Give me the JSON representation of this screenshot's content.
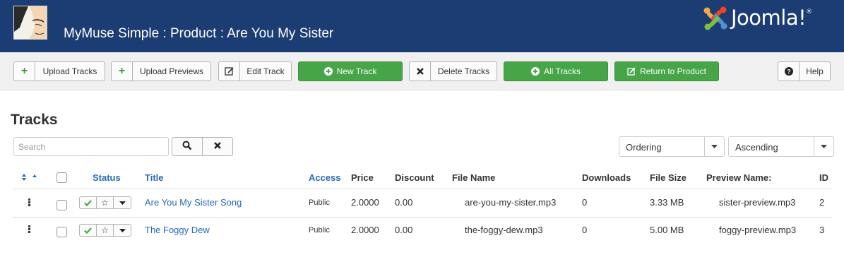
{
  "header": {
    "title": "MyMuse Simple : Product : Are You My Sister",
    "brand": "Joomla!",
    "brand_mark": "®"
  },
  "toolbar": {
    "upload_tracks": "Upload Tracks",
    "upload_previews": "Upload Previews",
    "edit_track": "Edit Track",
    "new_track": "New Track",
    "delete_tracks": "Delete Tracks",
    "all_tracks": "All Tracks",
    "return_to_product": "Return to Product",
    "help": "Help"
  },
  "section": {
    "title": "Tracks"
  },
  "filters": {
    "search_placeholder": "Search",
    "ordering": "Ordering",
    "direction": "Ascending"
  },
  "columns": {
    "status": "Status",
    "title": "Title",
    "access": "Access",
    "price": "Price",
    "discount": "Discount",
    "file_name": "File Name",
    "downloads": "Downloads",
    "file_size": "File Size",
    "preview_name": "Preview Name:",
    "id": "ID"
  },
  "rows": [
    {
      "title": "Are You My Sister Song",
      "access": "Public",
      "price": "2.0000",
      "discount": "0.00",
      "file_name": "are-you-my-sister.mp3",
      "downloads": "0",
      "file_size": "3.33 MB",
      "preview_name": "sister-preview.mp3",
      "id": "2"
    },
    {
      "title": "The Foggy Dew",
      "access": "Public",
      "price": "2.0000",
      "discount": "0.00",
      "file_name": "the-foggy-dew.mp3",
      "downloads": "0",
      "file_size": "5.00 MB",
      "preview_name": "foggy-preview.mp3",
      "id": "3"
    }
  ],
  "icons": {
    "plus": "plus-icon",
    "edit": "edit-icon",
    "delete": "x-icon",
    "circle_plus": "circle-plus-icon",
    "help": "question-icon",
    "search": "search-icon",
    "clear": "clear-icon",
    "sort": "sort-icon",
    "published": "check-icon",
    "featured": "star-icon",
    "dropdown": "caret-down-icon",
    "drag": "drag-handle-icon"
  },
  "colors": {
    "header_bg": "#1c3d74",
    "toolbar_bg": "#f0f0f0",
    "success": "#46a546",
    "link": "#2a69b8"
  }
}
